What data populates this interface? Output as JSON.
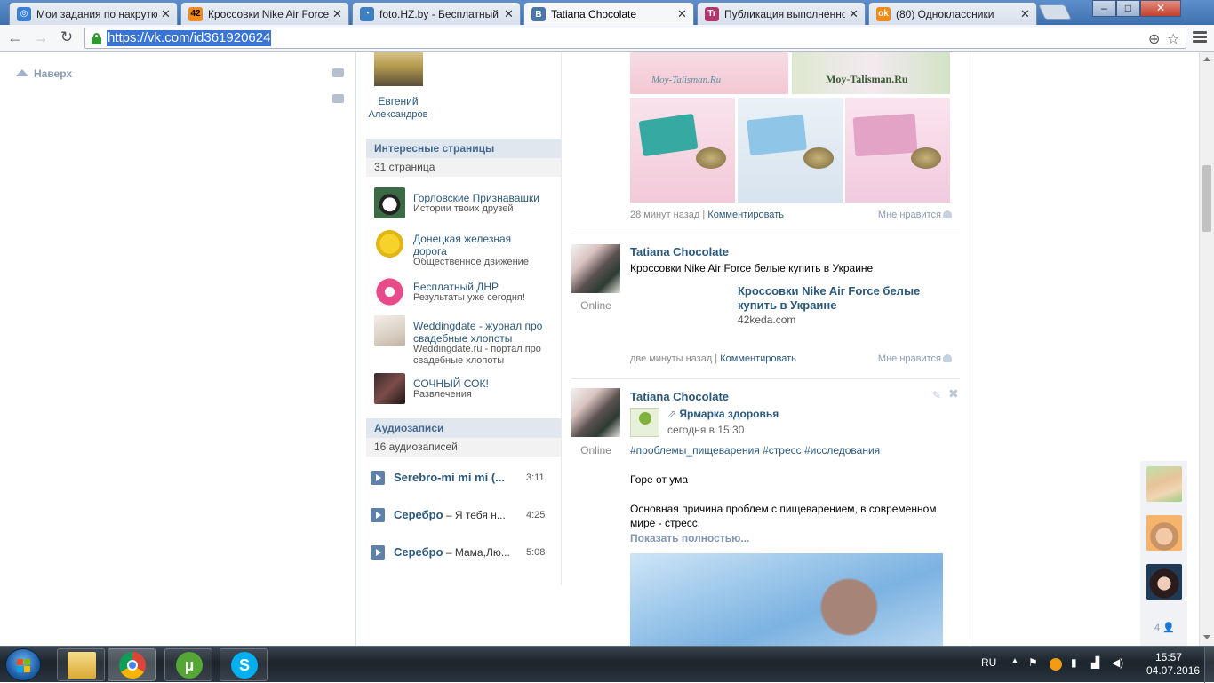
{
  "browser": {
    "tabs": [
      {
        "label": "Мои задания по накрутке",
        "favicon_color": "#3a7fd5",
        "favicon_char": "◎"
      },
      {
        "label": "Кроссовки Nike Air Force",
        "favicon_color": "#f08a1c",
        "favicon_char": "42"
      },
      {
        "label": "foto.HZ.by - Бесплатный",
        "favicon_color": "#3e7fc1",
        "favicon_char": "◔"
      },
      {
        "label": "Tatiana Chocolate",
        "favicon_color": "#4a76a8",
        "favicon_char": "B"
      },
      {
        "label": "Публикация выполненно",
        "favicon_color": "#b0366b",
        "favicon_char": "Tr"
      },
      {
        "label": "(80) Одноклассники",
        "favicon_color": "#ef8b18",
        "favicon_char": "ok"
      }
    ],
    "url": "https://vk.com/id361920624",
    "window_controls": {
      "minimize": "–",
      "maximize": "□",
      "close": "✕"
    }
  },
  "sidebar": {
    "back_to_top": "Наверх"
  },
  "friend": {
    "first_name": "Евгений",
    "last_name": "Александров"
  },
  "pages_block": {
    "title": "Интересные страницы",
    "count": "31 страница",
    "items": [
      {
        "title": "Горловские Признавашки",
        "desc": "Истории твоих друзей"
      },
      {
        "title": "Донецкая железная дорога",
        "desc": "Общественное движение"
      },
      {
        "title": "Бесплатный ДНР",
        "desc": "Результаты уже сегодня!"
      },
      {
        "title": "Weddingdate - журнал про свадебные хлопоты",
        "desc": "Weddingdate.ru - портал про свадебные хлопоты"
      },
      {
        "title": "СОЧНЫЙ СОК!",
        "desc": "Развлечения"
      }
    ]
  },
  "audio_block": {
    "title": "Аудиозаписи",
    "count": "16 аудиозаписей",
    "items": [
      {
        "artist": "Serebro",
        "song": "mi mi mi (...",
        "duration": "3:11",
        "sep": "-"
      },
      {
        "artist": "Серебро",
        "song": "Я тебя н...",
        "duration": "4:25",
        "sep": " – "
      },
      {
        "artist": "Серебро",
        "song": "Мама,Лю...",
        "duration": "5:08",
        "sep": " – "
      }
    ]
  },
  "wall": {
    "watermark": "Moy-Talisman.Ru",
    "post1": {
      "time": "28 минут назад",
      "comment": "Комментировать",
      "like": "Мне нравится"
    },
    "post2": {
      "author": "Tatiana Chocolate",
      "status": "Online",
      "text": "Кроссовки Nike Air Force белые купить в Украине",
      "link_title": "Кроссовки Nike Air Force белые купить в Украине",
      "link_domain": "42keda.com",
      "time": "две минуты назад",
      "comment": "Комментировать",
      "like": "Мне нравится"
    },
    "post3": {
      "author": "Tatiana Chocolate",
      "status": "Online",
      "repost_from": "Ярмарка здоровья",
      "repost_date": "сегодня в 15:30",
      "hashtags": "#проблемы_пищеварения #стресс #исследования",
      "line1": "Горе от ума",
      "line2": "Основная причина проблем с пищеварением, в современном мире - стресс.",
      "show_more": "Показать полностью..."
    }
  },
  "friends_online": {
    "count": "4"
  },
  "taskbar": {
    "lang": "RU",
    "time": "15:57",
    "date": "04.07.2016"
  }
}
